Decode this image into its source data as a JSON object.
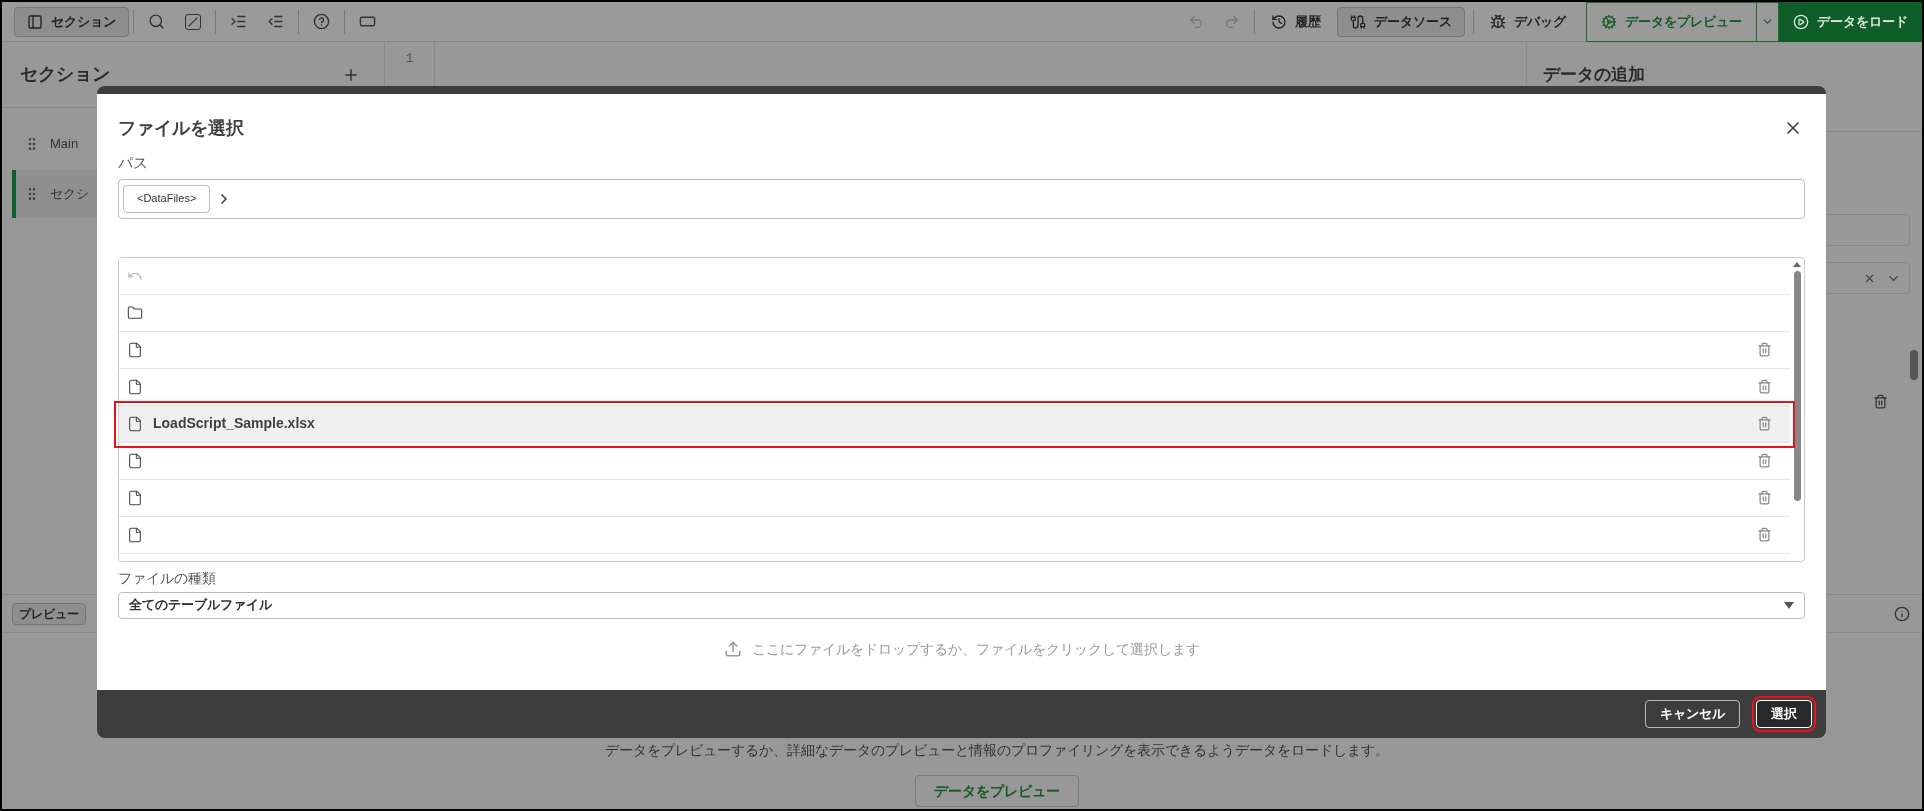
{
  "toolbar": {
    "section_toggle": {
      "label": "セクション",
      "selected": true
    },
    "history": {
      "label": "履歴"
    },
    "data_source": {
      "label": "データソース",
      "selected": true
    },
    "debug": {
      "label": "デバッグ"
    },
    "preview": {
      "label": "データをプレビュー"
    },
    "load": {
      "label": "データをロード"
    }
  },
  "sidebar": {
    "title": "セクション",
    "items": [
      {
        "label": "Main",
        "selected": false
      },
      {
        "label": "セクシ",
        "selected": true
      }
    ]
  },
  "editor": {
    "line_numbers": [
      "1"
    ]
  },
  "right_panel": {
    "title": "データの追加"
  },
  "preview_bar": {
    "button": "プレビュー"
  },
  "empty_preview": {
    "message": "データをプレビューするか、詳細なデータのプレビューと情報のプロファイリングを表示できるようデータをロードします。",
    "button": "データをプレビュー"
  },
  "dialog": {
    "title": "ファイルを選択",
    "path_label": "パス",
    "breadcrumbs": [
      "<DataFiles>"
    ],
    "files": [
      {
        "kind": "back",
        "selected": false,
        "annotated": false
      },
      {
        "kind": "folder",
        "selected": false,
        "annotated": false
      },
      {
        "kind": "file",
        "selected": false,
        "annotated": false
      },
      {
        "kind": "file",
        "selected": false,
        "annotated": false
      },
      {
        "kind": "file",
        "name": "LoadScript_Sample.xlsx",
        "selected": true,
        "annotated": true
      },
      {
        "kind": "file",
        "selected": false,
        "annotated": false
      },
      {
        "kind": "file",
        "selected": false,
        "annotated": false
      },
      {
        "kind": "file",
        "selected": false,
        "annotated": false
      }
    ],
    "file_type_label": "ファイルの種類",
    "file_type_value": "全てのテーブルファイル",
    "drop_hint": "ここにファイルをドロップするか、ファイルをクリックして選択します",
    "buttons": [
      {
        "label": "キャンセル",
        "kind": "cancel",
        "annotated": false
      },
      {
        "label": "選択",
        "kind": "confirm",
        "annotated": true
      }
    ]
  }
}
